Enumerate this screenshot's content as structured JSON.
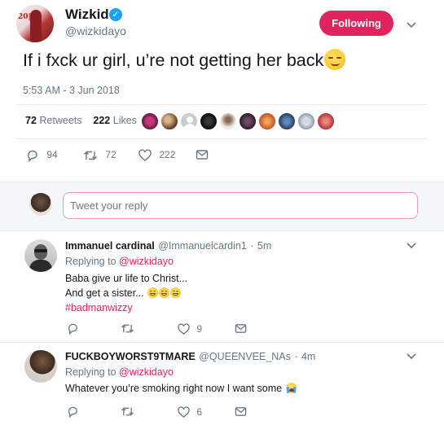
{
  "tweet": {
    "author_name": "Wizkid",
    "author_handle": "@wizkidayo",
    "follow_label": "Following",
    "text": "If i fxck ur girl, u’re not getting her back",
    "timestamp": "5:53 AM - 3 Jun 2018",
    "retweets_count": "72",
    "retweets_label": "Retweets",
    "likes_count": "222",
    "likes_label": "Likes",
    "actions": {
      "replies": "94",
      "retweets": "72",
      "likes": "222"
    },
    "accent_color": "#e0245e"
  },
  "composer": {
    "placeholder": "Tweet your reply"
  },
  "replies": [
    {
      "name": "Immanuel cardinal",
      "handle": "@Immanuelcardin1",
      "time": "5m",
      "replying_label": "Replying to",
      "replying_to": "@wizkidayo",
      "line1": "Baba give ur life to Christ...",
      "line2": "And get a sister...",
      "hashtag": "#badmanwizzy",
      "likes": "9"
    },
    {
      "name": "FUCKBOYWORST9TMARE",
      "handle": "@QUEENVEE_NAs",
      "time": "4m",
      "replying_label": "Replying to",
      "replying_to": "@wizkidayo",
      "line1": "Whatever you’re smoking right now I want some",
      "likes": "6"
    }
  ],
  "icons": [
    "verified-icon",
    "chevron-down-icon",
    "reply-icon",
    "retweet-icon",
    "like-icon",
    "dm-icon"
  ]
}
